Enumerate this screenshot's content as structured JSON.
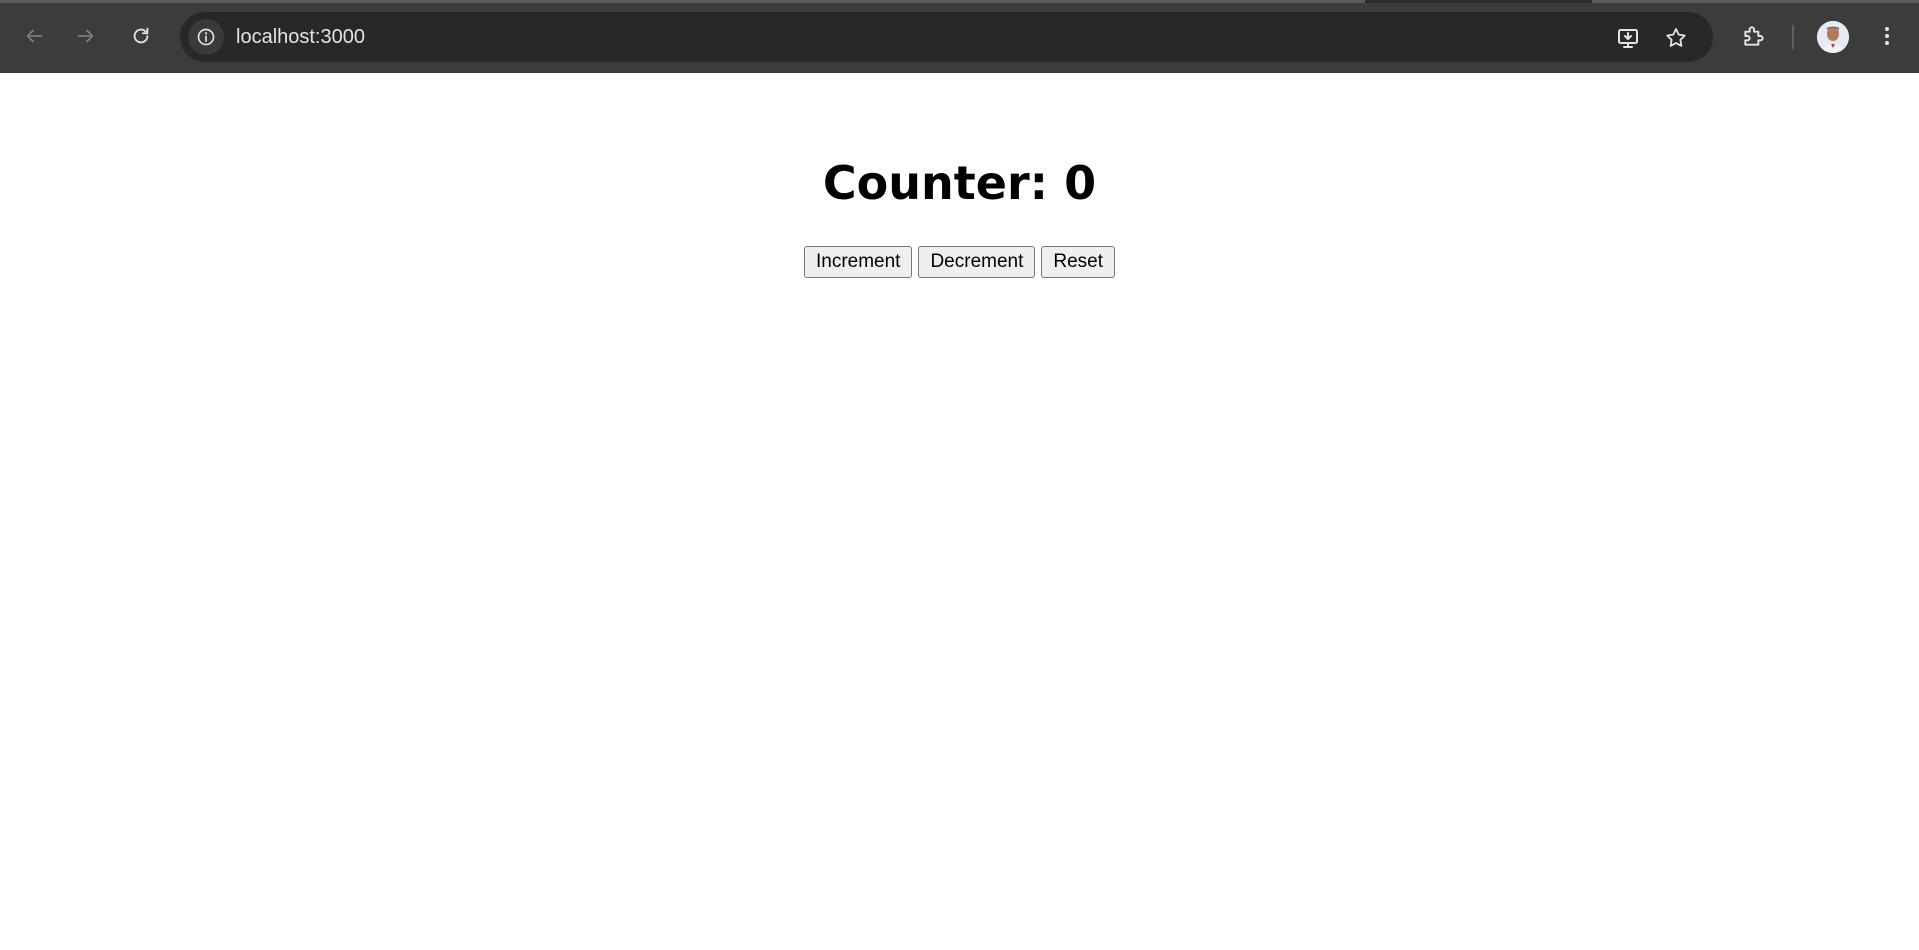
{
  "browser": {
    "url": "localhost:3000",
    "icons": {
      "back": "arrow-left-icon",
      "forward": "arrow-right-icon",
      "reload": "reload-icon",
      "site_info": "info-icon",
      "install": "install-app-icon",
      "bookmark": "star-icon",
      "extensions": "puzzle-icon",
      "profile": "avatar",
      "menu": "kebab-menu-icon"
    }
  },
  "app": {
    "title": "Counter: 0",
    "buttons": {
      "increment": "Increment",
      "decrement": "Decrement",
      "reset": "Reset"
    }
  }
}
